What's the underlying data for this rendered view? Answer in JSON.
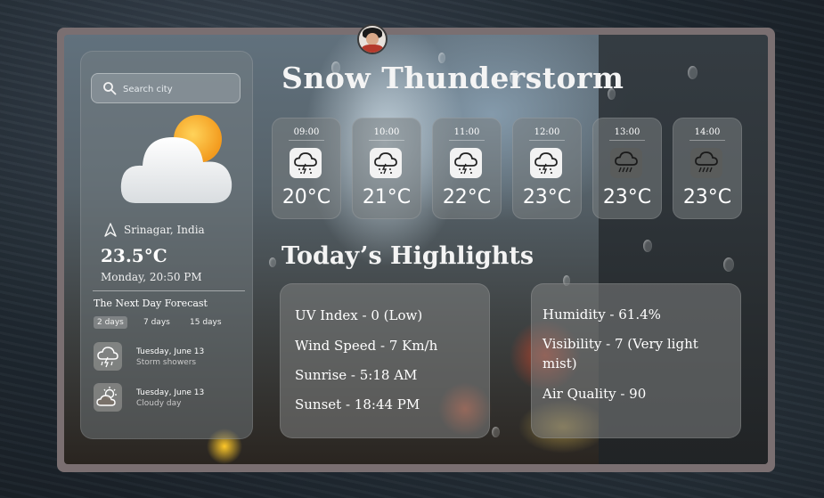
{
  "search": {
    "placeholder": "Search city"
  },
  "current": {
    "location": "Srinagar, India",
    "temperature": "23.5°C",
    "datetime": "Monday, 20:50 PM",
    "icon": "sun-behind-cloud-icon"
  },
  "next_forecast": {
    "title": "The Next Day Forecast",
    "ranges": [
      "2 days",
      "7 days",
      "15 days"
    ],
    "active_range": "2 days",
    "items": [
      {
        "date": "Tuesday, June 13",
        "summary": "Storm showers",
        "icon": "storm-showers-icon"
      },
      {
        "date": "Tuesday, June 13",
        "summary": "Cloudy day",
        "icon": "cloudy-day-icon"
      }
    ]
  },
  "headline": "Snow Thunderstorm",
  "hourly": [
    {
      "time": "09:00",
      "temp": "20°C",
      "icon": "snow-thunderstorm-icon"
    },
    {
      "time": "10:00",
      "temp": "21°C",
      "icon": "snow-thunderstorm-icon"
    },
    {
      "time": "11:00",
      "temp": "22°C",
      "icon": "snow-thunderstorm-icon"
    },
    {
      "time": "12:00",
      "temp": "23°C",
      "icon": "snow-thunderstorm-icon"
    },
    {
      "time": "13:00",
      "temp": "23°C",
      "icon": "rain-cloud-icon"
    },
    {
      "time": "14:00",
      "temp": "23°C",
      "icon": "rain-cloud-icon"
    }
  ],
  "highlights_title": "Today’s Highlights",
  "highlights_left": [
    "UV Index - 0 (Low)",
    "Wind Speed - 7 Km/h",
    "Sunrise - 5:18 AM",
    "Sunset - 18:44 PM"
  ],
  "highlights_right": [
    "Humidity - 61.4%",
    "Visibility - 7 (Very light mist)",
    "Air Quality - 90"
  ],
  "colors": {
    "sun": "#f5a623",
    "panel": "#7a6f71"
  }
}
